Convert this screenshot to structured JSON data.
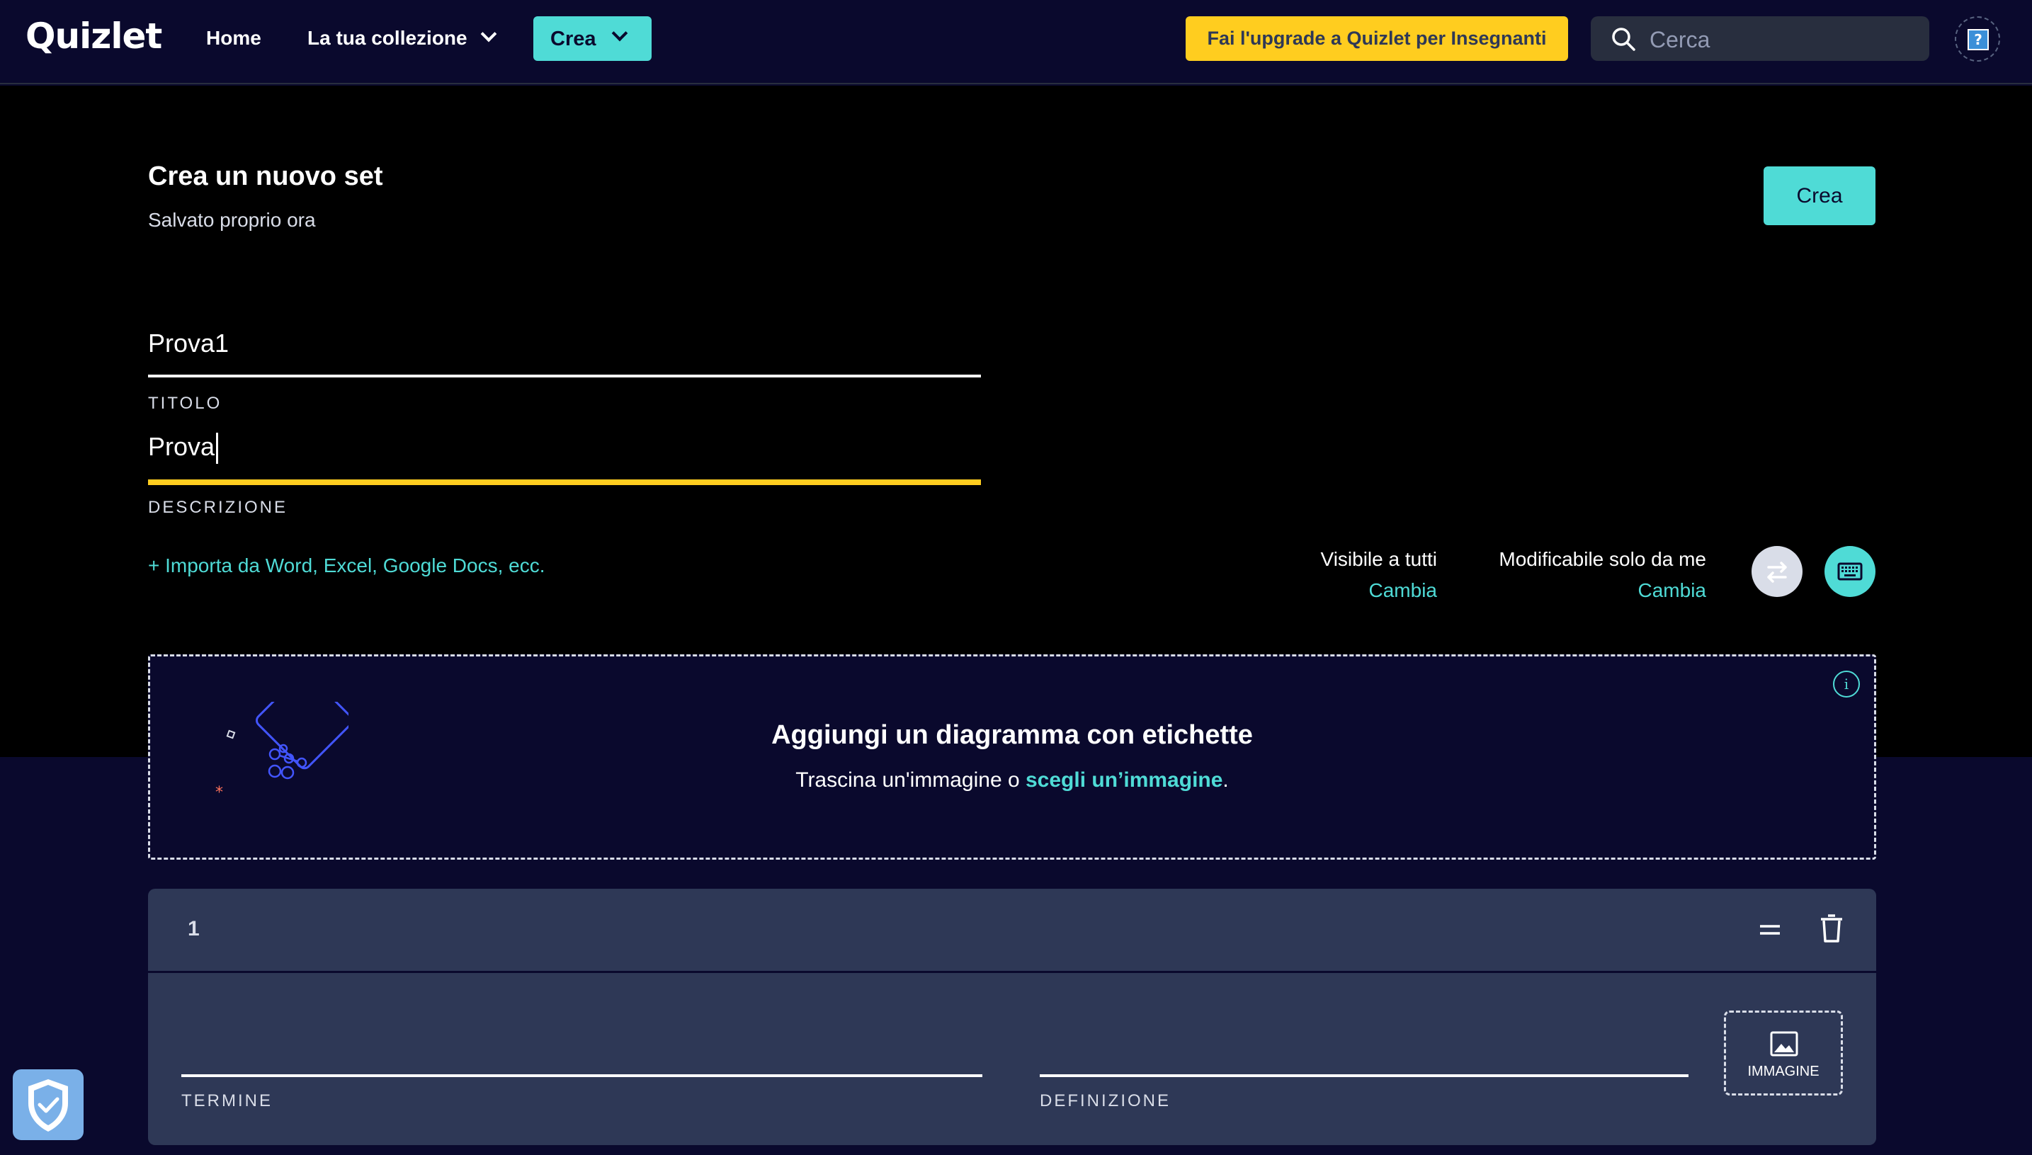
{
  "header": {
    "logo": "Quizlet",
    "nav": {
      "home": "Home",
      "collection": "La tua collezione",
      "create": "Crea"
    },
    "upgrade_label": "Fai l'upgrade a Quizlet per Insegnanti",
    "search_placeholder": "Cerca",
    "help_icon": "?"
  },
  "page": {
    "title": "Crea un nuovo set",
    "status": "Salvato proprio ora",
    "create_button": "Crea"
  },
  "form": {
    "title_value": "Prova1",
    "title_label": "TITOLO",
    "description_value": "Prova",
    "description_label": "DESCRIZIONE",
    "import_link": "+ Importa da Word, Excel, Google Docs, ecc."
  },
  "settings": {
    "visibility": {
      "label": "Visibile a tutti",
      "change": "Cambia"
    },
    "editing": {
      "label": "Modificabile solo da me",
      "change": "Cambia"
    }
  },
  "diagram": {
    "heading": "Aggiungi un diagramma con etichette",
    "sub_prefix": "Trascina un'immagine o ",
    "sub_link": "scegli un’immagine",
    "sub_suffix": ".",
    "info_icon": "i"
  },
  "card": {
    "number": "1",
    "term_label": "TERMINE",
    "definition_label": "DEFINIZIONE",
    "image_label": "IMMAGINE"
  },
  "colors": {
    "accent": "#4fdbd6",
    "upgrade": "#ffcd1f",
    "background": "#0a092d",
    "card": "#2e3856"
  }
}
